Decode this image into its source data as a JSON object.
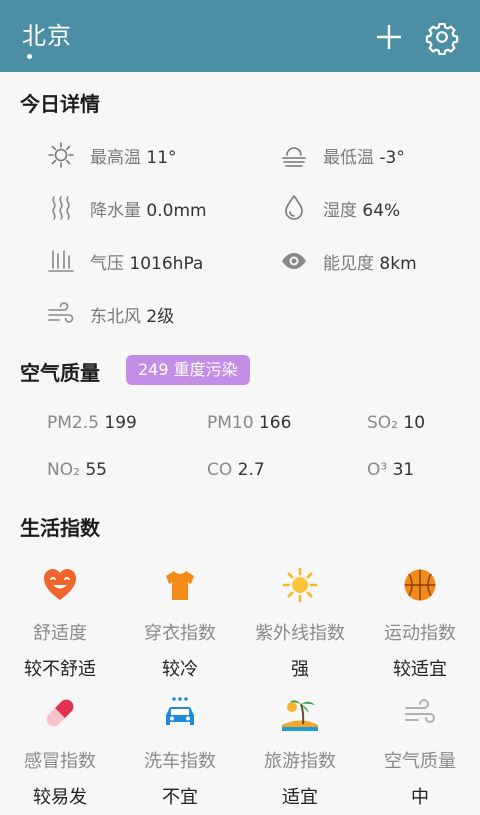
{
  "header": {
    "city": "北京"
  },
  "today": {
    "title": "今日详情",
    "items": [
      {
        "label": "最高温",
        "value": "11°",
        "icon": "sun-icon"
      },
      {
        "label": "最低温",
        "value": "-3°",
        "icon": "fog-icon"
      },
      {
        "label": "降水量",
        "value": "0.0mm",
        "icon": "precipitation-icon"
      },
      {
        "label": "湿度",
        "value": "64%",
        "icon": "humidity-drop-icon"
      },
      {
        "label": "气压",
        "value": "1016hPa",
        "icon": "pressure-icon"
      },
      {
        "label": "能见度",
        "value": "8km",
        "icon": "eye-icon"
      },
      {
        "label": "东北风",
        "value": "2级",
        "icon": "wind-icon"
      }
    ]
  },
  "air": {
    "title": "空气质量",
    "badge": "249  重度污染",
    "badge_color": "#c38ee5",
    "items": [
      {
        "label": "PM2.5",
        "value": "199"
      },
      {
        "label": "PM10",
        "value": "166"
      },
      {
        "label": "SO₂",
        "value": "10"
      },
      {
        "label": "NO₂",
        "value": "55"
      },
      {
        "label": "CO",
        "value": "2.7"
      },
      {
        "label": "O³",
        "value": "31"
      }
    ]
  },
  "life": {
    "title": "生活指数",
    "items": [
      {
        "name": "舒适度",
        "value": "较不舒适",
        "icon": "heart-face-icon"
      },
      {
        "name": "穿衣指数",
        "value": "较冷",
        "icon": "tshirt-icon"
      },
      {
        "name": "紫外线指数",
        "value": "强",
        "icon": "sun-uv-icon"
      },
      {
        "name": "运动指数",
        "value": "较适宜",
        "icon": "basketball-icon"
      },
      {
        "name": "感冒指数",
        "value": "较易发",
        "icon": "pill-icon"
      },
      {
        "name": "洗车指数",
        "value": "不宜",
        "icon": "car-wash-icon"
      },
      {
        "name": "旅游指数",
        "value": "适宜",
        "icon": "palm-island-icon"
      },
      {
        "name": "空气质量",
        "value": "中",
        "icon": "air-wind-icon"
      }
    ]
  }
}
